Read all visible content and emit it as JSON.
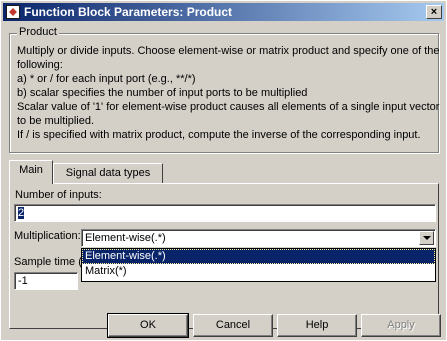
{
  "window": {
    "title": "Function Block Parameters: Product",
    "close_glyph": "×"
  },
  "description": {
    "group_title": "Product",
    "lines": [
      "Multiply or divide inputs.  Choose element-wise or matrix product and specify one of the",
      "following:",
      "a) * or / for each input port (e.g., **/*)",
      "b) scalar specifies the number of input ports to be multiplied",
      "Scalar value of '1' for element-wise product causes all elements of a single input vector",
      "to be multiplied.",
      "If / is specified with matrix product, compute the inverse of the corresponding input."
    ]
  },
  "tabs": [
    {
      "label": "Main",
      "active": true
    },
    {
      "label": "Signal data types",
      "active": false
    }
  ],
  "main": {
    "inputs_label": "Number of inputs:",
    "inputs_value": "2",
    "multiplication_label": "Multiplication:",
    "multiplication_value": "Element-wise(.*)",
    "multiplication_options": [
      "Element-wise(.*)",
      "Matrix(*)"
    ],
    "sample_time_label": "Sample time (-",
    "sample_time_value": "-1"
  },
  "buttons": {
    "ok": "OK",
    "cancel": "Cancel",
    "help": "Help",
    "apply": "Apply"
  },
  "colors": {
    "titlebar_start": "#0a246a",
    "titlebar_end": "#a6caf0",
    "selection": "#0a246a",
    "face": "#d4d0c8"
  }
}
